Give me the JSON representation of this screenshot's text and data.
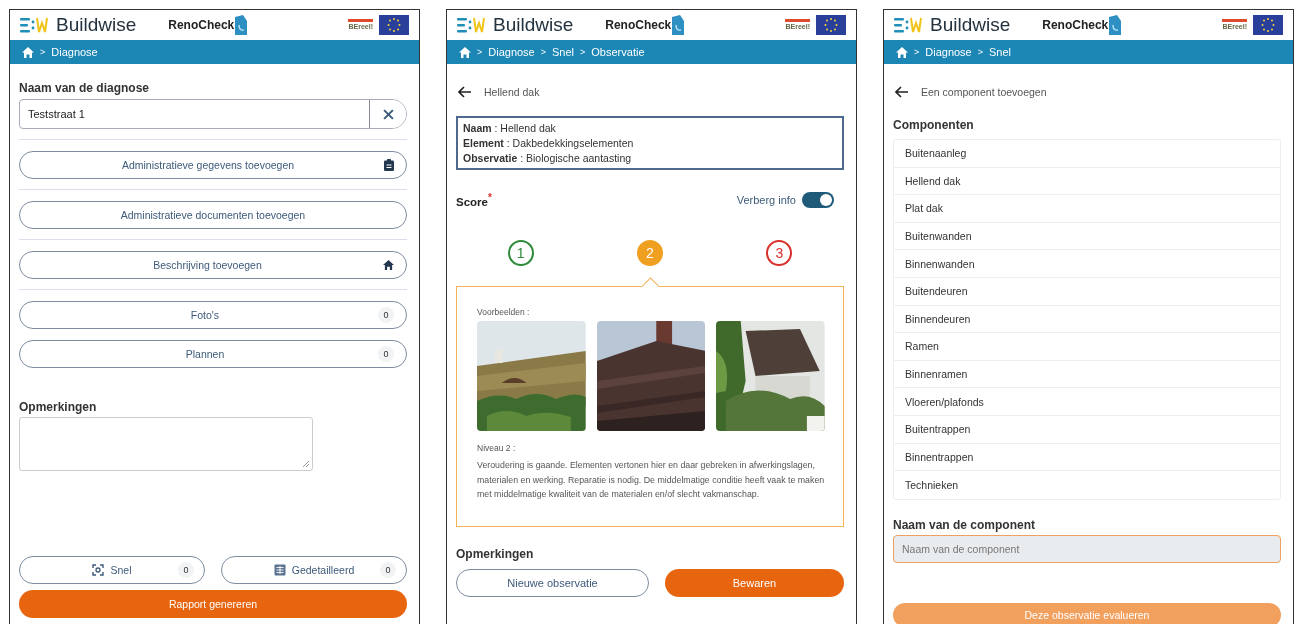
{
  "screens": [
    {
      "kind": "diagnosis",
      "header": {
        "brand": "Buildwise",
        "app": "RenoCheck",
        "partner": "BEreel!"
      },
      "breadcrumb": {
        "separator": ">",
        "items": [
          "Diagnose"
        ]
      },
      "name_field": {
        "label": "Naam van de diagnose",
        "value": "Teststraat 1"
      },
      "actions": [
        {
          "label": "Administratieve gegevens toevoegen",
          "kind": "clipboard"
        },
        {
          "label": "Administratieve documenten toevoegen",
          "kind": "plain"
        },
        {
          "label": "Beschrijving toevoegen",
          "kind": "home"
        },
        {
          "label": "Foto's",
          "kind": "count",
          "count": "0"
        },
        {
          "label": "Plannen",
          "kind": "count",
          "count": "0"
        }
      ],
      "remarks": {
        "label": "Opmerkingen"
      },
      "modes": [
        {
          "label": "Snel",
          "kind": "quick",
          "count": "0"
        },
        {
          "label": "Gedetailleerd",
          "kind": "detailed",
          "count": "0"
        }
      ],
      "primary_button": "Rapport genereren"
    },
    {
      "kind": "observation",
      "header": {
        "brand": "Buildwise",
        "app": "RenoCheck",
        "partner": "BEreel!"
      },
      "breadcrumb": {
        "separator": ">",
        "items": [
          "Diagnose",
          "Snel",
          "Observatie"
        ]
      },
      "back": "Hellend dak",
      "info": [
        "**Naam** : Hellend dak",
        "**Element** : Dakbedekkingselementen",
        "**Observatie** : Biologische aantasting"
      ],
      "score": {
        "label": "Score",
        "required_mark": "*"
      },
      "toggle": {
        "label": "Verberg info",
        "on": true
      },
      "levels": [
        {
          "label": "1",
          "color": "#2e8b3a",
          "selected": false
        },
        {
          "label": "2",
          "color": "#f0a020",
          "selected": true
        },
        {
          "label": "3",
          "color": "#d9302c",
          "selected": false
        }
      ],
      "panel": {
        "examples_label": "Voorbeelden :",
        "level_title": "Niveau 2 :",
        "description": "Veroudering is gaande. Elementen vertonen hier en daar gebreken in afwerkingslagen, materialen en werking. Reparatie is nodig. De middelmatige conditie heeft vaak te maken met middelmatige kwaliteit van de materialen en/of slecht vakmanschap."
      },
      "remarks": {
        "label": "Opmerkingen"
      },
      "buttons": [
        {
          "label": "Nieuwe observatie",
          "kind": "secondary"
        },
        {
          "label": "Bewaren",
          "kind": "primary"
        }
      ]
    },
    {
      "kind": "components",
      "header": {
        "brand": "Buildwise",
        "app": "RenoCheck",
        "partner": "BEreel!"
      },
      "breadcrumb": {
        "separator": ">",
        "items": [
          "Diagnose",
          "Snel"
        ]
      },
      "back": "Een component toevoegen",
      "list_title": "Componenten",
      "items": [
        "Buitenaanleg",
        "Hellend dak",
        "Plat dak",
        "Buitenwanden",
        "Binnenwanden",
        "Buitendeuren",
        "Binnendeuren",
        "Ramen",
        "Binnenramen",
        "Vloeren/plafonds",
        "Buitentrappen",
        "Binnentrappen",
        "Technieken"
      ],
      "name_field": {
        "label": "Naam van de component",
        "placeholder": "Naam van de component"
      },
      "submit": {
        "label": "Deze observatie evalueren",
        "disabled": true
      }
    }
  ]
}
